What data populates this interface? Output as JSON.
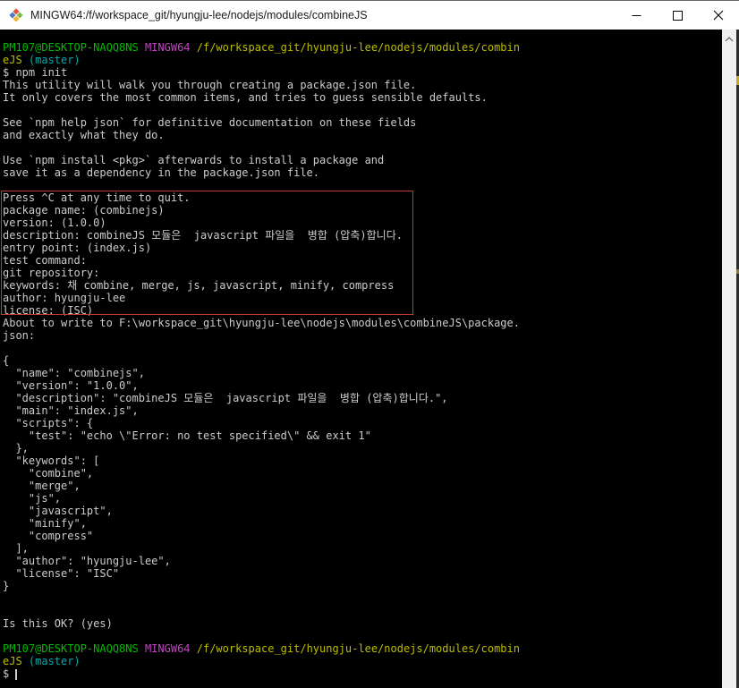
{
  "window": {
    "title": "MINGW64:/f/workspace_git/hyungju-lee/nodejs/modules/combineJS",
    "icons": {
      "app": "git-bash-diamond-icon",
      "minimize": "—",
      "maximize": "□",
      "close": "✕",
      "scroll_up": "chevron-up"
    }
  },
  "colors": {
    "background": "#000000",
    "foreground": "#cccccc",
    "green": "#00bb00",
    "magenta": "#c544c5",
    "yellow": "#bdbd00",
    "cyan": "#00aeae",
    "annotation_red": "#c23b33",
    "titlebar_bg": "#ffffff",
    "titlebar_fg": "#1a1a1a",
    "scrollbar_track": "#f0f0f0",
    "scrollbar_arrow": "#606060"
  },
  "terminal": {
    "cursor_style": "bar",
    "lines": [
      [
        {
          "t": "PM107@DESKTOP-NAQQ8NS ",
          "c": "green"
        },
        {
          "t": "MINGW64 ",
          "c": "magenta"
        },
        {
          "t": "/f/workspace_git/hyungju-lee/nodejs/modules/combin",
          "c": "yellow"
        }
      ],
      [
        {
          "t": "eJS ",
          "c": "yellow"
        },
        {
          "t": "(master)",
          "c": "cyan"
        }
      ],
      [
        {
          "t": "$ npm init"
        }
      ],
      [
        {
          "t": "This utility will walk you through creating a package.json file."
        }
      ],
      [
        {
          "t": "It only covers the most common items, and tries to guess sensible defaults."
        }
      ],
      [],
      [
        {
          "t": "See `npm help json` for definitive documentation on these fields"
        }
      ],
      [
        {
          "t": "and exactly what they do."
        }
      ],
      [],
      [
        {
          "t": "Use `npm install <pkg>` afterwards to install a package and"
        }
      ],
      [
        {
          "t": "save it as a dependency in the package.json file."
        }
      ],
      [],
      [
        {
          "t": "Press ^C at any time to quit."
        }
      ],
      [
        {
          "t": "package name: (combinejs)"
        }
      ],
      [
        {
          "t": "version: (1.0.0)"
        }
      ],
      [
        {
          "t": "description: combineJS 모듈은  javascript 파일을  병합 (압축)합니다."
        }
      ],
      [
        {
          "t": "entry point: (index.js)"
        }
      ],
      [
        {
          "t": "test command:"
        }
      ],
      [
        {
          "t": "git repository:"
        }
      ],
      [
        {
          "t": "keywords: 채 combine, merge, js, javascript, minify, compress"
        }
      ],
      [
        {
          "t": "author: hyungju-lee"
        }
      ],
      [
        {
          "t": "license: (ISC)"
        }
      ],
      [
        {
          "t": "About to write to F:\\workspace_git\\hyungju-lee\\nodejs\\modules\\combineJS\\package."
        }
      ],
      [
        {
          "t": "json:"
        }
      ],
      [],
      [
        {
          "t": "{"
        }
      ],
      [
        {
          "t": "  \"name\": \"combinejs\","
        }
      ],
      [
        {
          "t": "  \"version\": \"1.0.0\","
        }
      ],
      [
        {
          "t": "  \"description\": \"combineJS 모듈은  javascript 파일을  병합 (압축)합니다.\","
        }
      ],
      [
        {
          "t": "  \"main\": \"index.js\","
        }
      ],
      [
        {
          "t": "  \"scripts\": {"
        }
      ],
      [
        {
          "t": "    \"test\": \"echo \\\"Error: no test specified\\\" && exit 1\""
        }
      ],
      [
        {
          "t": "  },"
        }
      ],
      [
        {
          "t": "  \"keywords\": ["
        }
      ],
      [
        {
          "t": "    \"combine\","
        }
      ],
      [
        {
          "t": "    \"merge\","
        }
      ],
      [
        {
          "t": "    \"js\","
        }
      ],
      [
        {
          "t": "    \"javascript\","
        }
      ],
      [
        {
          "t": "    \"minify\","
        }
      ],
      [
        {
          "t": "    \"compress\""
        }
      ],
      [
        {
          "t": "  ],"
        }
      ],
      [
        {
          "t": "  \"author\": \"hyungju-lee\","
        }
      ],
      [
        {
          "t": "  \"license\": \"ISC\""
        }
      ],
      [
        {
          "t": "}"
        }
      ],
      [],
      [],
      [
        {
          "t": "Is this OK? (yes)"
        }
      ],
      [],
      [
        {
          "t": "PM107@DESKTOP-NAQQ8NS ",
          "c": "green"
        },
        {
          "t": "MINGW64 ",
          "c": "magenta"
        },
        {
          "t": "/f/workspace_git/hyungju-lee/nodejs/modules/combin",
          "c": "yellow"
        }
      ],
      [
        {
          "t": "eJS ",
          "c": "yellow"
        },
        {
          "t": "(master)",
          "c": "cyan"
        }
      ],
      [
        {
          "t": "$ "
        },
        {
          "cursor": true
        }
      ]
    ]
  }
}
